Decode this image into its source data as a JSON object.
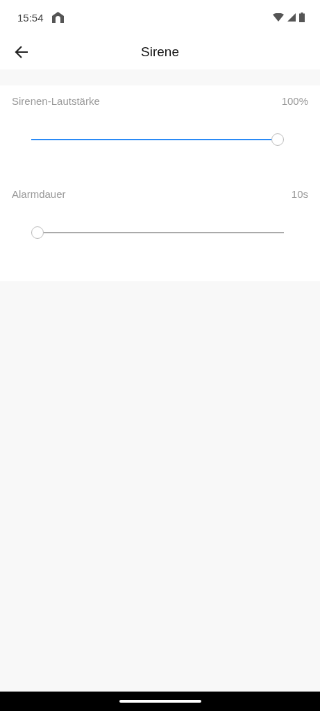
{
  "status_bar": {
    "time": "15:54"
  },
  "header": {
    "title": "Sirene"
  },
  "settings": [
    {
      "label": "Sirenen-Lautstärke",
      "reading": "100%",
      "level": 1.0
    },
    {
      "label": "Alarmdauer",
      "reading": "10s",
      "level": 0.0
    }
  ]
}
